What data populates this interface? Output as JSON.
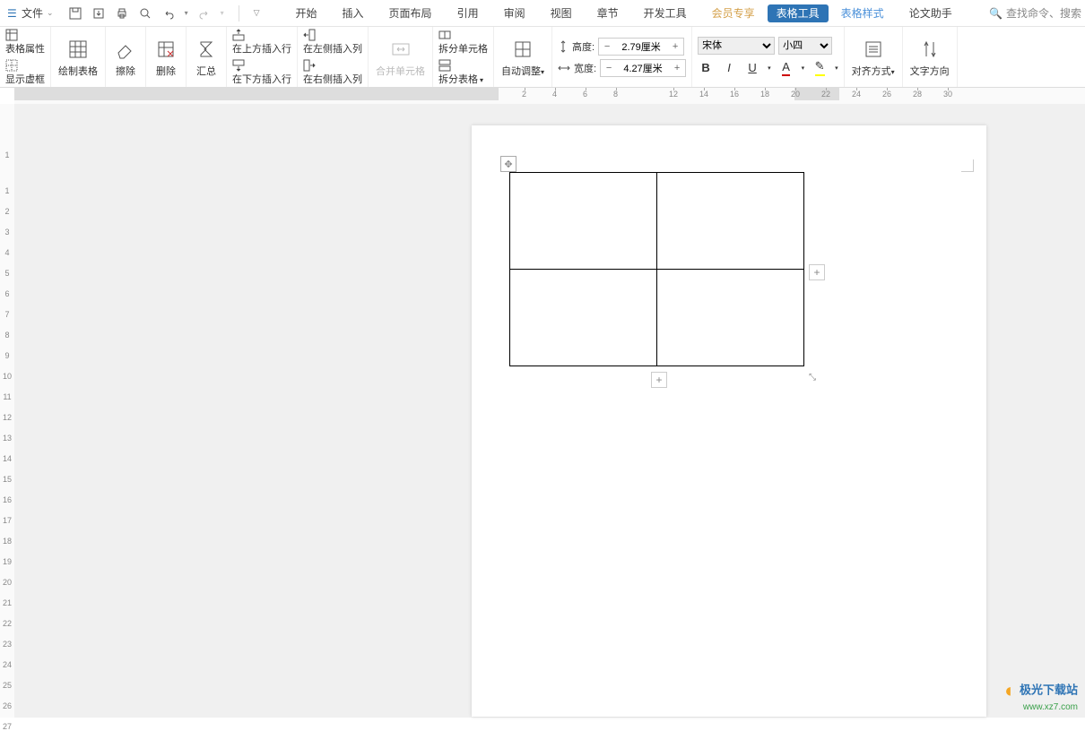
{
  "file_menu": {
    "label": "文件"
  },
  "tabs": {
    "start": "开始",
    "insert": "插入",
    "page_layout": "页面布局",
    "reference": "引用",
    "review": "审阅",
    "view": "视图",
    "chapter": "章节",
    "devtools": "开发工具",
    "member": "会员专享",
    "table_tools": "表格工具",
    "table_style": "表格样式",
    "thesis": "论文助手"
  },
  "search": {
    "placeholder": "查找命令、搜索"
  },
  "ribbon": {
    "table_props": "表格属性",
    "show_grid": "显示虚框",
    "draw_table": "绘制表格",
    "eraser": "擦除",
    "delete": "删除",
    "sum": "汇总",
    "insert_above": "在上方插入行",
    "insert_below": "在下方插入行",
    "insert_left": "在左侧插入列",
    "insert_right": "在右侧插入列",
    "merge_cells": "合并单元格",
    "split_cells": "拆分单元格",
    "split_table": "拆分表格",
    "autofit": "自动调整",
    "height_label": "高度:",
    "height_value": "2.79厘米",
    "width_label": "宽度:",
    "width_value": "4.27厘米",
    "font_name": "宋体",
    "font_size": "小四",
    "align": "对齐方式",
    "text_dir": "文字方向"
  },
  "ruler_h": [
    "2",
    "4",
    "6",
    "8",
    "12",
    "14",
    "16",
    "18",
    "20",
    "22",
    "24",
    "26",
    "28",
    "30"
  ],
  "ruler_v": [
    "1",
    "1",
    "2",
    "3",
    "4",
    "5",
    "6",
    "7",
    "8",
    "9",
    "10",
    "11",
    "12",
    "13",
    "14",
    "15",
    "16",
    "17",
    "18",
    "19",
    "20",
    "21",
    "22",
    "23",
    "24",
    "25",
    "26",
    "27"
  ],
  "watermark": {
    "cn": "极光下载站",
    "url": "www.xz7.com"
  }
}
